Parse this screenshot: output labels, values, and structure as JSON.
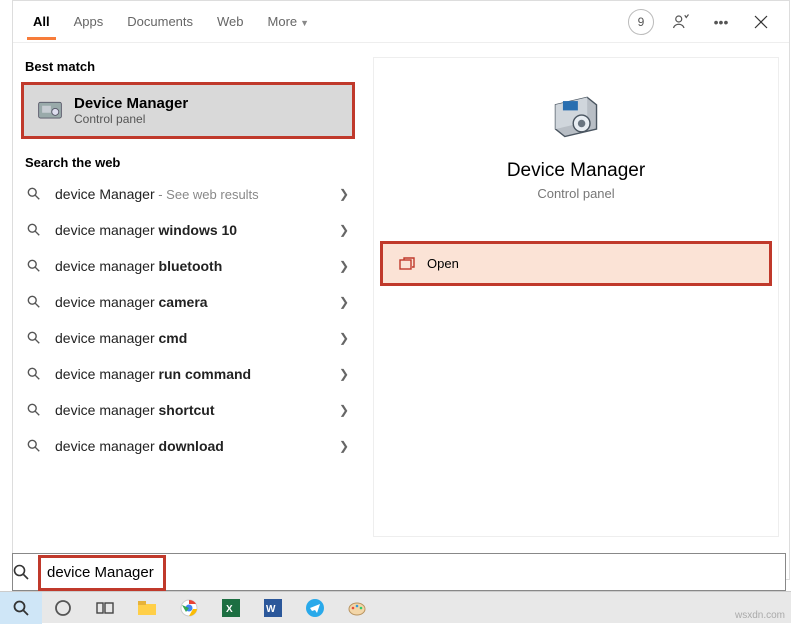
{
  "tabs": {
    "all": "All",
    "apps": "Apps",
    "documents": "Documents",
    "web": "Web",
    "more": "More"
  },
  "badge": "9",
  "sections": {
    "best": "Best match",
    "web": "Search the web"
  },
  "bestMatch": {
    "title": "Device Manager",
    "subtitle": "Control panel"
  },
  "webResults": [
    {
      "prefix": "device Manager",
      "bold": "",
      "hint": " - See web results"
    },
    {
      "prefix": "device manager ",
      "bold": "windows 10",
      "hint": ""
    },
    {
      "prefix": "device manager ",
      "bold": "bluetooth",
      "hint": ""
    },
    {
      "prefix": "device manager ",
      "bold": "camera",
      "hint": ""
    },
    {
      "prefix": "device manager ",
      "bold": "cmd",
      "hint": ""
    },
    {
      "prefix": "device manager ",
      "bold": "run command",
      "hint": ""
    },
    {
      "prefix": "device manager ",
      "bold": "shortcut",
      "hint": ""
    },
    {
      "prefix": "device manager ",
      "bold": "download",
      "hint": ""
    }
  ],
  "preview": {
    "title": "Device Manager",
    "subtitle": "Control panel",
    "open": "Open"
  },
  "search": {
    "value": "device Manager"
  },
  "watermark": "wsxdn.com"
}
